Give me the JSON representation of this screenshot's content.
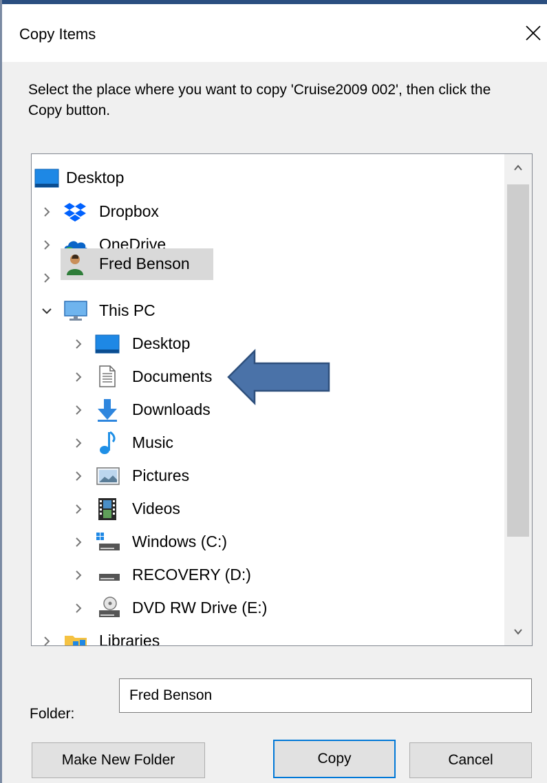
{
  "dialog": {
    "title": "Copy Items",
    "instruction": "Select the place where you want to copy 'Cruise2009 002', then click the Copy button."
  },
  "tree": {
    "items": [
      {
        "label": "Desktop",
        "icon": "desktop-icon"
      },
      {
        "label": "Dropbox",
        "icon": "dropbox-icon"
      },
      {
        "label": "OneDrive",
        "icon": "onedrive-icon"
      },
      {
        "label": "Fred Benson",
        "icon": "user-icon",
        "selected": true
      },
      {
        "label": "This PC",
        "icon": "computer-icon",
        "expanded": true
      },
      {
        "label": "Desktop",
        "icon": "desktop-icon"
      },
      {
        "label": "Documents",
        "icon": "documents-icon"
      },
      {
        "label": "Downloads",
        "icon": "download-arrow-icon"
      },
      {
        "label": "Music",
        "icon": "music-note-icon"
      },
      {
        "label": "Pictures",
        "icon": "pictures-icon"
      },
      {
        "label": "Videos",
        "icon": "film-icon"
      },
      {
        "label": "Windows (C:)",
        "icon": "system-drive-icon"
      },
      {
        "label": "RECOVERY (D:)",
        "icon": "drive-icon"
      },
      {
        "label": "DVD RW Drive (E:)",
        "icon": "dvd-drive-icon"
      },
      {
        "label": "Libraries",
        "icon": "libraries-icon"
      }
    ]
  },
  "folder": {
    "label": "Folder:",
    "value": "Fred Benson"
  },
  "buttons": {
    "make_new_folder": "Make New Folder",
    "copy": "Copy",
    "cancel": "Cancel"
  },
  "colors": {
    "accent": "#0078d7",
    "annotation_arrow": "#4a72a8"
  }
}
